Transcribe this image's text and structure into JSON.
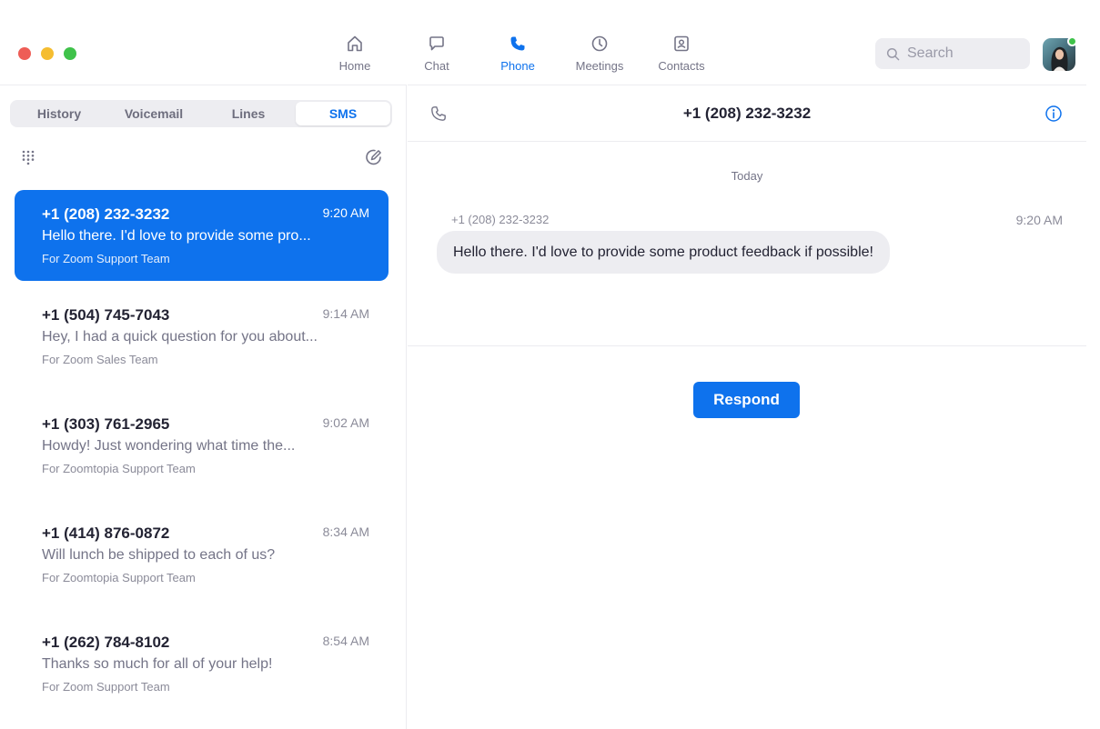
{
  "colors": {
    "accent": "#0e72ed",
    "online": "#3fc24a"
  },
  "nav": {
    "items": [
      {
        "label": "Home",
        "icon": "home-icon"
      },
      {
        "label": "Chat",
        "icon": "chat-icon"
      },
      {
        "label": "Phone",
        "icon": "phone-icon",
        "active": true
      },
      {
        "label": "Meetings",
        "icon": "clock-icon"
      },
      {
        "label": "Contacts",
        "icon": "contacts-icon"
      }
    ]
  },
  "search": {
    "placeholder": "Search"
  },
  "tabs": [
    {
      "label": "History"
    },
    {
      "label": "Voicemail"
    },
    {
      "label": "Lines"
    },
    {
      "label": "SMS",
      "active": true
    }
  ],
  "conversations": [
    {
      "number": "+1 (208) 232-3232",
      "time": "9:20 AM",
      "preview": "Hello there. I'd love to provide some pro...",
      "team": "For Zoom Support Team",
      "selected": true
    },
    {
      "number": "+1 (504) 745-7043",
      "time": "9:14 AM",
      "preview": "Hey, I had a quick question for you about...",
      "team": "For Zoom Sales Team"
    },
    {
      "number": "+1 (303) 761-2965",
      "time": "9:02 AM",
      "preview": "Howdy! Just wondering what time the...",
      "team": "For Zoomtopia Support Team"
    },
    {
      "number": "+1 (414) 876-0872",
      "time": "8:34 AM",
      "preview": "Will lunch be shipped to each of us?",
      "team": "For Zoomtopia Support Team"
    },
    {
      "number": "+1 (262) 784-8102",
      "time": "8:54 AM",
      "preview": "Thanks so much for all of your help!",
      "team": "For Zoom Support Team"
    }
  ],
  "thread": {
    "title": "+1 (208) 232-3232",
    "day_label": "Today",
    "messages": [
      {
        "sender": "+1 (208) 232-3232",
        "time": "9:20 AM",
        "text": "Hello there. I'd love to provide some product feedback if possible!"
      }
    ],
    "respond_label": "Respond"
  }
}
